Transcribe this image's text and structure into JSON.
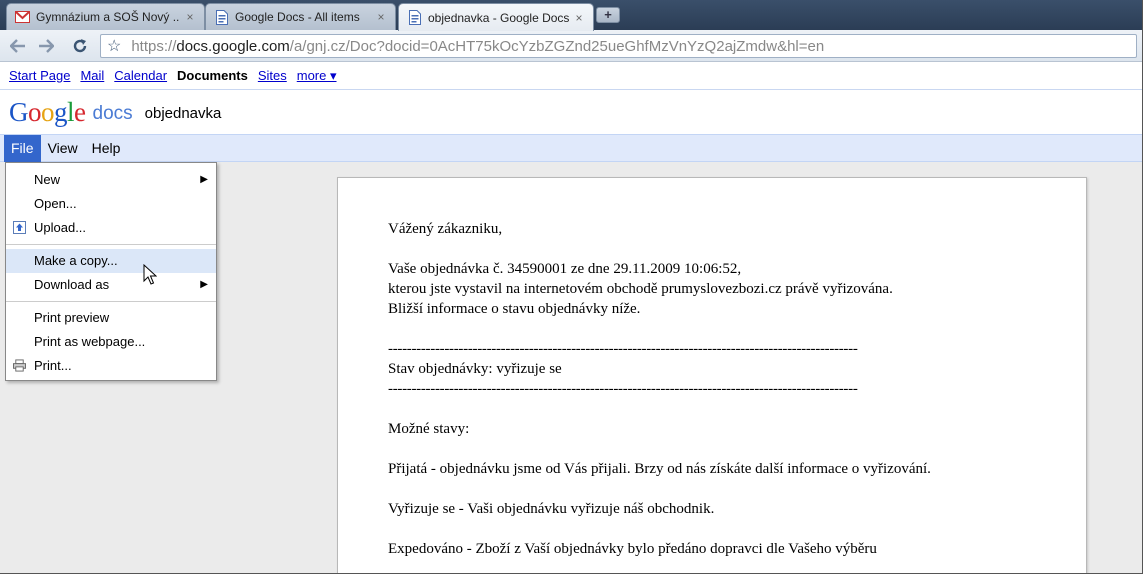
{
  "browser": {
    "tabs": [
      {
        "title": "Gymnázium a SOŠ Nový ...",
        "icon": "gmail-icon"
      },
      {
        "title": "Google Docs - All items",
        "icon": "docs-icon"
      },
      {
        "title": "objednavka - Google Docs",
        "icon": "docs-icon"
      }
    ],
    "close_glyph": "×",
    "new_tab_glyph": "+",
    "url": {
      "scheme": "https://",
      "host": "docs.google.com",
      "path": "/a/gnj.cz/Doc?docid=0AcHT75kOcYzbZGZnd25ueGhfMzVnYzQ2ajZmdw&hl=en"
    }
  },
  "gbar": {
    "links": [
      "Start Page",
      "Mail",
      "Calendar"
    ],
    "current": "Documents",
    "links_after": [
      "Sites"
    ],
    "more": "more ▾"
  },
  "header": {
    "logo_letters": [
      "G",
      "o",
      "o",
      "g",
      "l",
      "e"
    ],
    "product": "docs",
    "doc_title": "objednavka"
  },
  "menubar": {
    "items": [
      "File",
      "View",
      "Help"
    ]
  },
  "file_menu": {
    "items": [
      {
        "label": "New",
        "submenu": true
      },
      {
        "label": "Open..."
      },
      {
        "label": "Upload..."
      },
      {
        "label": "Make a copy..."
      },
      {
        "label": "Download as",
        "submenu": true
      },
      {
        "label": "Print preview"
      },
      {
        "label": "Print as webpage..."
      },
      {
        "label": "Print..."
      }
    ],
    "highlighted": "Make a copy...",
    "submenu_arrow": "▶"
  },
  "document": {
    "lines": [
      "Vážený zákazniku,",
      "Vaše objednávka č. 34590001 ze dne 29.11.2009 10:06:52,",
      "kterou jste vystavil na internetovém obchodě prumyslovezbozi.cz právě vyřizována.",
      "Bližší informace o stavu objednávky níže.",
      "----------------------------------------------------------------------------------------------------",
      "Stav objednávky: vyřizuje se",
      "----------------------------------------------------------------------------------------------------",
      "Možné stavy:",
      "Přijatá - objednávku jsme od Vás přijali. Brzy od nás získáte další informace o vyřizování.",
      "Vyřizuje se - Vaši objednávku vyřizuje náš obchodnik.",
      "Expedováno - Zboží z Vaší objednávky bylo předáno dopravci dle Vašeho výběru"
    ]
  },
  "colors": {
    "menubar_bg": "#e0e9fb",
    "menu_active": "#3366cc",
    "menu_highlight": "#dbe7f8",
    "link": "#0000cc"
  }
}
